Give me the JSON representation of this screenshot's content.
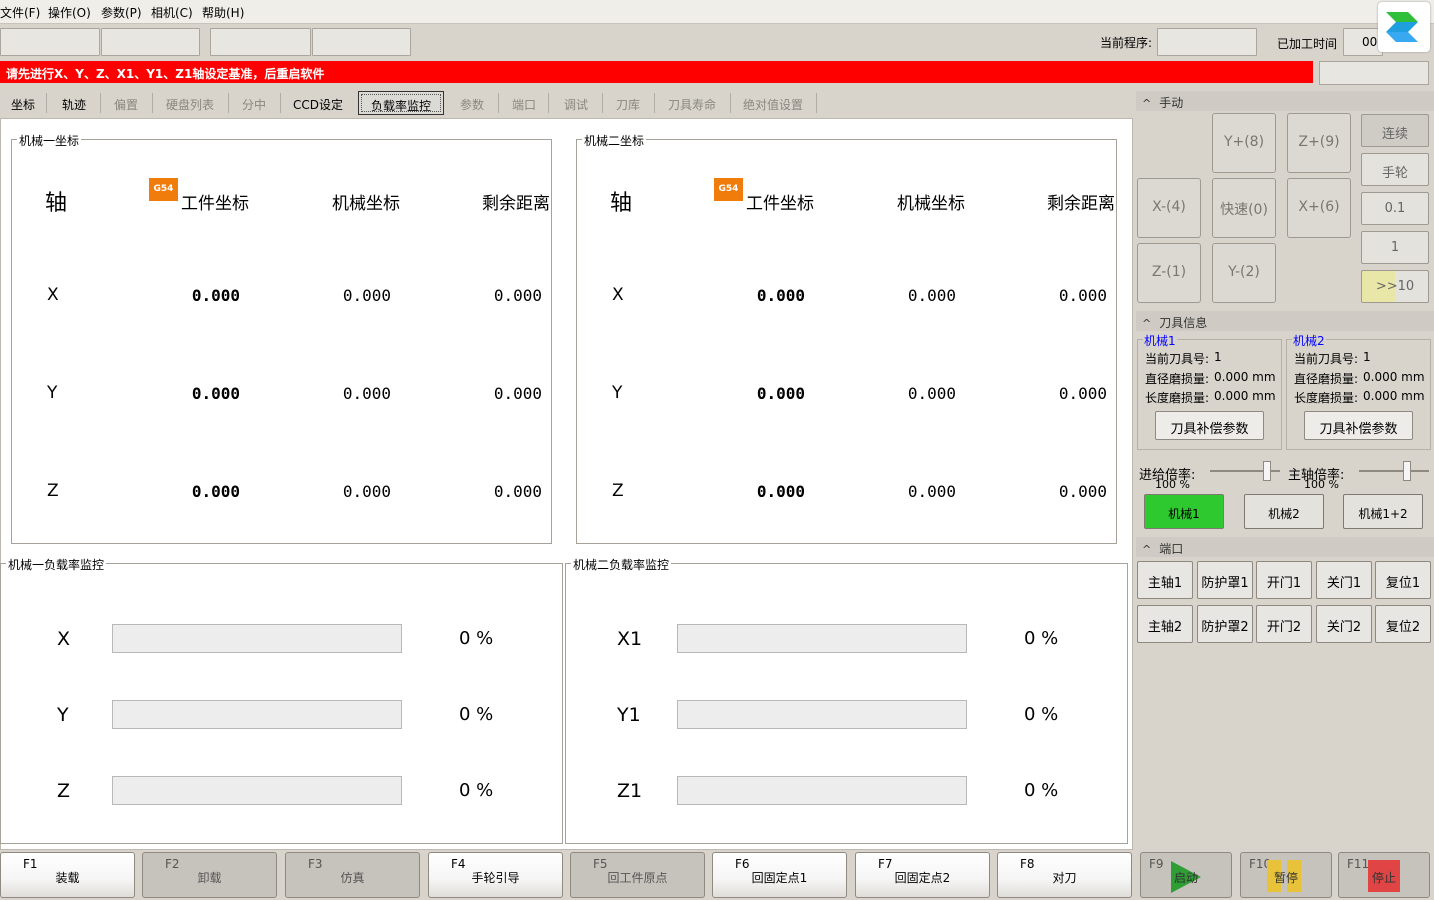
{
  "menu": [
    "文件(F)",
    "操作(O)",
    "参数(P)",
    "相机(C)",
    "帮助(H)"
  ],
  "status": {
    "program_label": "当前程序:",
    "program_value": "",
    "time_label": "已加工时间",
    "time_value": "00:"
  },
  "alert": "请先进行X、Y、Z、X1、Y1、Z1轴设定基准，后重启软件",
  "tabs": [
    "坐标",
    "轨迹",
    "偏置",
    "硬盘列表",
    "分中",
    "CCD设定",
    "负载率监控",
    "参数",
    "端口",
    "调试",
    "刀库",
    "刀具寿命",
    "绝对值设置"
  ],
  "active_tab": "负载率监控",
  "machine1": {
    "title": "机械一坐标",
    "badge": "G54",
    "headers": {
      "axis": "轴",
      "work": "工件坐标",
      "machine": "机械坐标",
      "remain": "剩余距离"
    },
    "rows": [
      {
        "axis": "X",
        "work": "0.000",
        "machine": "0.000",
        "remain": "0.000"
      },
      {
        "axis": "Y",
        "work": "0.000",
        "machine": "0.000",
        "remain": "0.000"
      },
      {
        "axis": "Z",
        "work": "0.000",
        "machine": "0.000",
        "remain": "0.000"
      }
    ]
  },
  "machine2": {
    "title": "机械二坐标",
    "badge": "G54",
    "headers": {
      "axis": "轴",
      "work": "工件坐标",
      "machine": "机械坐标",
      "remain": "剩余距离"
    },
    "rows": [
      {
        "axis": "X",
        "work": "0.000",
        "machine": "0.000",
        "remain": "0.000"
      },
      {
        "axis": "Y",
        "work": "0.000",
        "machine": "0.000",
        "remain": "0.000"
      },
      {
        "axis": "Z",
        "work": "0.000",
        "machine": "0.000",
        "remain": "0.000"
      }
    ]
  },
  "load1": {
    "title": "机械一负载率监控",
    "rows": [
      {
        "axis": "X",
        "percent": 0,
        "label": "0 %"
      },
      {
        "axis": "Y",
        "percent": 0,
        "label": "0 %"
      },
      {
        "axis": "Z",
        "percent": 0,
        "label": "0 %"
      }
    ]
  },
  "load2": {
    "title": "机械二负载率监控",
    "rows": [
      {
        "axis": "X1",
        "percent": 0,
        "label": "0 %"
      },
      {
        "axis": "Y1",
        "percent": 0,
        "label": "0 %"
      },
      {
        "axis": "Z1",
        "percent": 0,
        "label": "0 %"
      }
    ]
  },
  "manual": {
    "title": "手动",
    "jog": {
      "y_plus": "Y+(8)",
      "z_plus": "Z+(9)",
      "x_minus": "X-(4)",
      "rapid": "快速(0)",
      "x_plus": "X+(6)",
      "z_minus": "Z-(1)",
      "y_minus": "Y-(2)"
    },
    "modes": [
      "连续",
      "手轮",
      "0.1",
      "1",
      ">>10"
    ]
  },
  "tool": {
    "title": "刀具信息",
    "m1": {
      "label": "机械1",
      "current": "当前刀具号:",
      "current_val": "1",
      "dia": "直径磨损量:",
      "dia_val": "0.000 mm",
      "len": "长度磨损量:",
      "len_val": "0.000 mm",
      "btn": "刀具补偿参数"
    },
    "m2": {
      "label": "机械2",
      "current": "当前刀具号:",
      "current_val": "1",
      "dia": "直径磨损量:",
      "dia_val": "0.000 mm",
      "len": "长度磨损量:",
      "len_val": "0.000 mm",
      "btn": "刀具补偿参数"
    }
  },
  "rates": {
    "feed_label": "进给倍率:",
    "feed_value": "100 %",
    "feed_level": 1.0,
    "spindle_label": "主轴倍率:",
    "spindle_value": "100 %",
    "spindle_level": 1.0
  },
  "machines": {
    "m1": "机械1",
    "m2": "机械2",
    "m12": "机械1+2",
    "active_color": "#2ec92e"
  },
  "port": {
    "title": "端口",
    "row1": [
      "主轴1",
      "防护罩1",
      "开门1",
      "关门1",
      "复位1"
    ],
    "row2": [
      "主轴2",
      "防护罩2",
      "开门2",
      "关门2",
      "复位2"
    ]
  },
  "fkeys": [
    {
      "key": "F1",
      "label": "装载"
    },
    {
      "key": "F2",
      "label": "卸载"
    },
    {
      "key": "F3",
      "label": "仿真"
    },
    {
      "key": "F4",
      "label": "手轮引导"
    },
    {
      "key": "F5",
      "label": "回工件原点"
    },
    {
      "key": "F6",
      "label": "回固定点1"
    },
    {
      "key": "F7",
      "label": "回固定点2"
    },
    {
      "key": "F8",
      "label": "对刀"
    },
    {
      "key": "F9",
      "label": "启动"
    },
    {
      "key": "F10",
      "label": "暂停"
    },
    {
      "key": "F11",
      "label": "停止"
    }
  ],
  "colors": {
    "alert": "#ff0000",
    "badge": "#f07c0c",
    "start": "#2f9e35",
    "pause": "#e8c33a",
    "stop": "#e04444"
  }
}
